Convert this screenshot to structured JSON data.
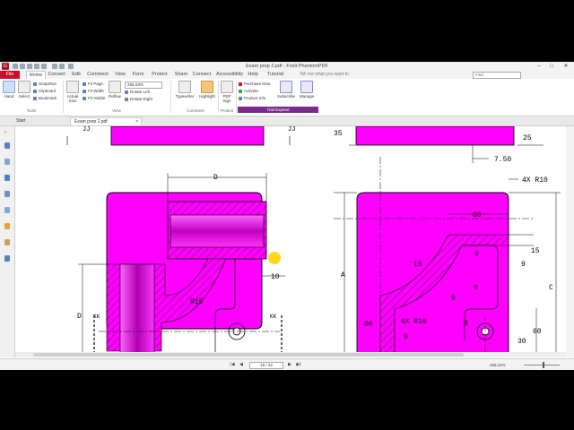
{
  "window": {
    "title": "Exam prep 2.pdf - Foxit PhantomPDF",
    "minimize": "–",
    "maximize": "□",
    "close": "✕"
  },
  "app_logo": "G",
  "menu": {
    "file": "File",
    "tabs": [
      "Home",
      "Convert",
      "Edit",
      "Comment",
      "View",
      "Form",
      "Protect",
      "Share",
      "Connect",
      "Accessibility",
      "Help",
      "Tutorial"
    ],
    "tell_me": "Tell me what you want to",
    "find_placeholder": "Find"
  },
  "ribbon": {
    "hand": "Hand",
    "select": "Select",
    "snapshot": "SnapShot",
    "clipboard": "Clipboard",
    "bookmark": "Bookmark",
    "actual_size": "Actual Size",
    "fit_page": "Fit Page",
    "fit_width": "Fit Width",
    "fit_visible": "Fit Visible",
    "zoom_value": "255.23%",
    "reflow": "Reflow",
    "rotate_left": "Rotate Left",
    "rotate_right": "Rotate Right",
    "typewriter": "Typewriter",
    "highlight": "Highlight",
    "pdf_sign": "PDF Sign",
    "purchase_now": "Purchase Now",
    "activate": "Activate",
    "product_info": "Product Info",
    "subscribe": "Subscribe",
    "manage": "Manage",
    "groups": {
      "tools": "Tools",
      "view": "View",
      "comment": "Comment",
      "protect": "Protect"
    },
    "trial": "Trial Expired"
  },
  "doc_tabs": {
    "start": "Start",
    "file": "Exam prep 2.pdf",
    "close": "×"
  },
  "status": {
    "page": "18 / 32",
    "zoom": "255.23%",
    "first": "|◀",
    "prev": "◀",
    "next": "▶",
    "last": "▶|"
  },
  "drawing": {
    "labels": {
      "jj_left_a": "JJ",
      "jj_left_b": "JJ",
      "jj_right": "JJ",
      "dim_35": "35",
      "dim_25": "25",
      "dim_750": "7.50",
      "dim_d_top": "D",
      "dim_d_side": "D",
      "dim_10": "10",
      "dim_r15": "R15",
      "kk_left": "KK",
      "kk_right": "KK",
      "note_4xr10": "4X R10",
      "dim_80_top": "80",
      "dim_15_right": "15",
      "dim_a": "A",
      "dim_15_curve": "15",
      "dim_9_a": "9",
      "dim_9_b": "9",
      "dim_9_c": "9",
      "dim_9_d": "9",
      "dim_9_e": "9",
      "dim_9_f": "9",
      "dim_c": "C",
      "dim_80_left": "80",
      "note_6xr10": "6X R10",
      "dim_30": "30",
      "dim_60": "60"
    },
    "colors": {
      "part": "#ff00ff",
      "hatch": "#7a007a",
      "line": "#000000"
    }
  }
}
